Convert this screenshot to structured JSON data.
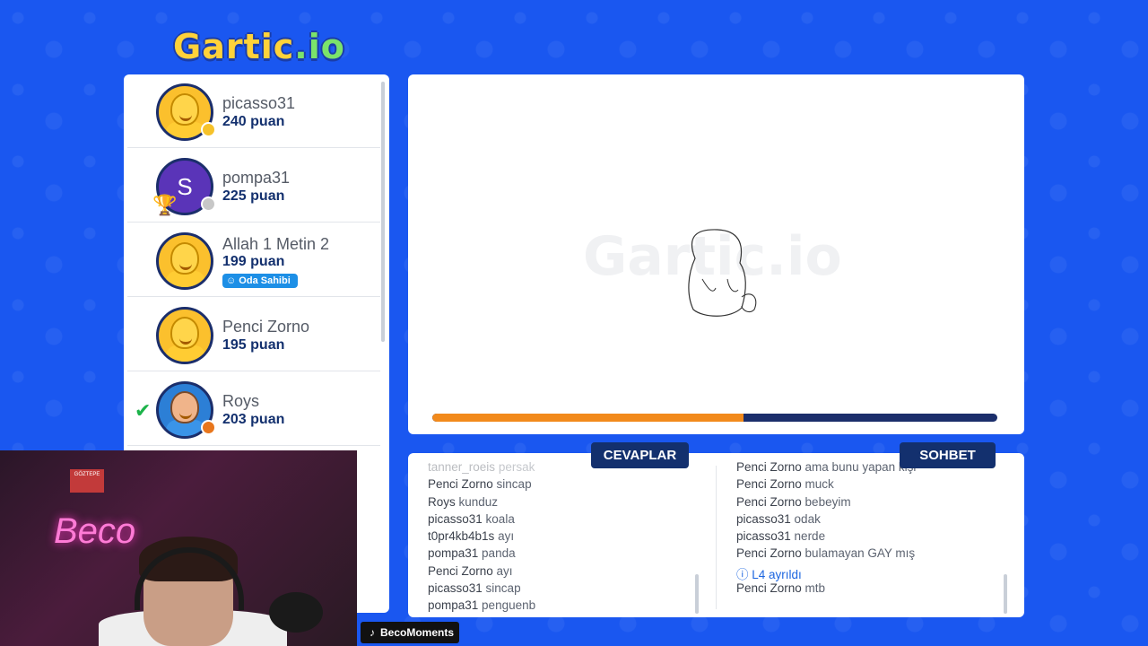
{
  "logo": {
    "text": "Gartic",
    "suffix": ".io"
  },
  "players": [
    {
      "name": "picasso31",
      "score": "240 puan",
      "status_color": "#f6c22a",
      "avatar": "face"
    },
    {
      "name": "pompa31",
      "score": "225 puan",
      "status_color": "#c7c7c7",
      "avatar": "letter",
      "letter": "S",
      "trophy_rank": "1"
    },
    {
      "name": "Allah 1 Metin 2",
      "score": "199 puan",
      "avatar": "face",
      "badge": "Oda Sahibi"
    },
    {
      "name": "Penci Zorno",
      "score": "195 puan",
      "avatar": "face"
    },
    {
      "name": "Roys",
      "score": "203 puan",
      "status_color": "#e8761c",
      "avatar": "roys",
      "guessed": true
    }
  ],
  "canvas": {
    "watermark": "Gartic.io",
    "timer_progress": 0.55
  },
  "tabs": {
    "answers": "CEVAPLAR",
    "chat": "SOHBET"
  },
  "answers": [
    {
      "user": "tanner_roeis",
      "text": "persak",
      "faded": true
    },
    {
      "user": "Penci Zorno",
      "text": "sincap"
    },
    {
      "user": "Roys",
      "text": "kunduz"
    },
    {
      "user": "picasso31",
      "text": "koala"
    },
    {
      "user": "t0pr4kb4b1s",
      "text": "ayı"
    },
    {
      "user": "pompa31",
      "text": "panda"
    },
    {
      "user": "Penci Zorno",
      "text": "ayı"
    },
    {
      "user": "picasso31",
      "text": "sincap"
    },
    {
      "user": "pompa31",
      "text": "penguenb"
    }
  ],
  "chat": [
    {
      "user": "Penci Zorno",
      "text": "ama bunu yapan kişi"
    },
    {
      "user": "Penci Zorno",
      "text": "muck"
    },
    {
      "user": "Penci Zorno",
      "text": "bebeyim"
    },
    {
      "user": "picasso31",
      "text": "odak"
    },
    {
      "user": "picasso31",
      "text": "nerde"
    },
    {
      "user": "Penci Zorno",
      "text": "bulamayan GAY mış"
    },
    {
      "user": "L4",
      "text": "ayrıldı",
      "system": true
    },
    {
      "user": "Penci Zorno",
      "text": "mtb"
    }
  ],
  "webcam": {
    "neon_text": "Beco",
    "sticker": "GÖZTEPE"
  },
  "channel_tag": "BecoMoments"
}
